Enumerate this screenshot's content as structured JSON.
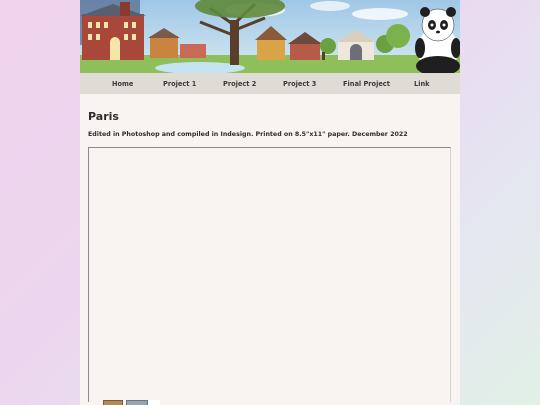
{
  "nav": {
    "items": [
      "Home",
      "Project 1",
      "Project 2",
      "Project 3",
      "Final Project",
      "Link"
    ]
  },
  "content": {
    "title": "Paris",
    "caption": "Edited in Photoshop and compiled in Indesign. Printed on 8.5\"x11\" paper. December 2022"
  },
  "colors": {
    "background_gradient": [
      "#f0d3ec",
      "#e2f0e6"
    ],
    "page": "#f8f4f1",
    "nav_bar": "#dedcd4",
    "text": "#2d2d2d"
  },
  "icons": {
    "banner": "campus-illustration-with-panda-mascot"
  }
}
